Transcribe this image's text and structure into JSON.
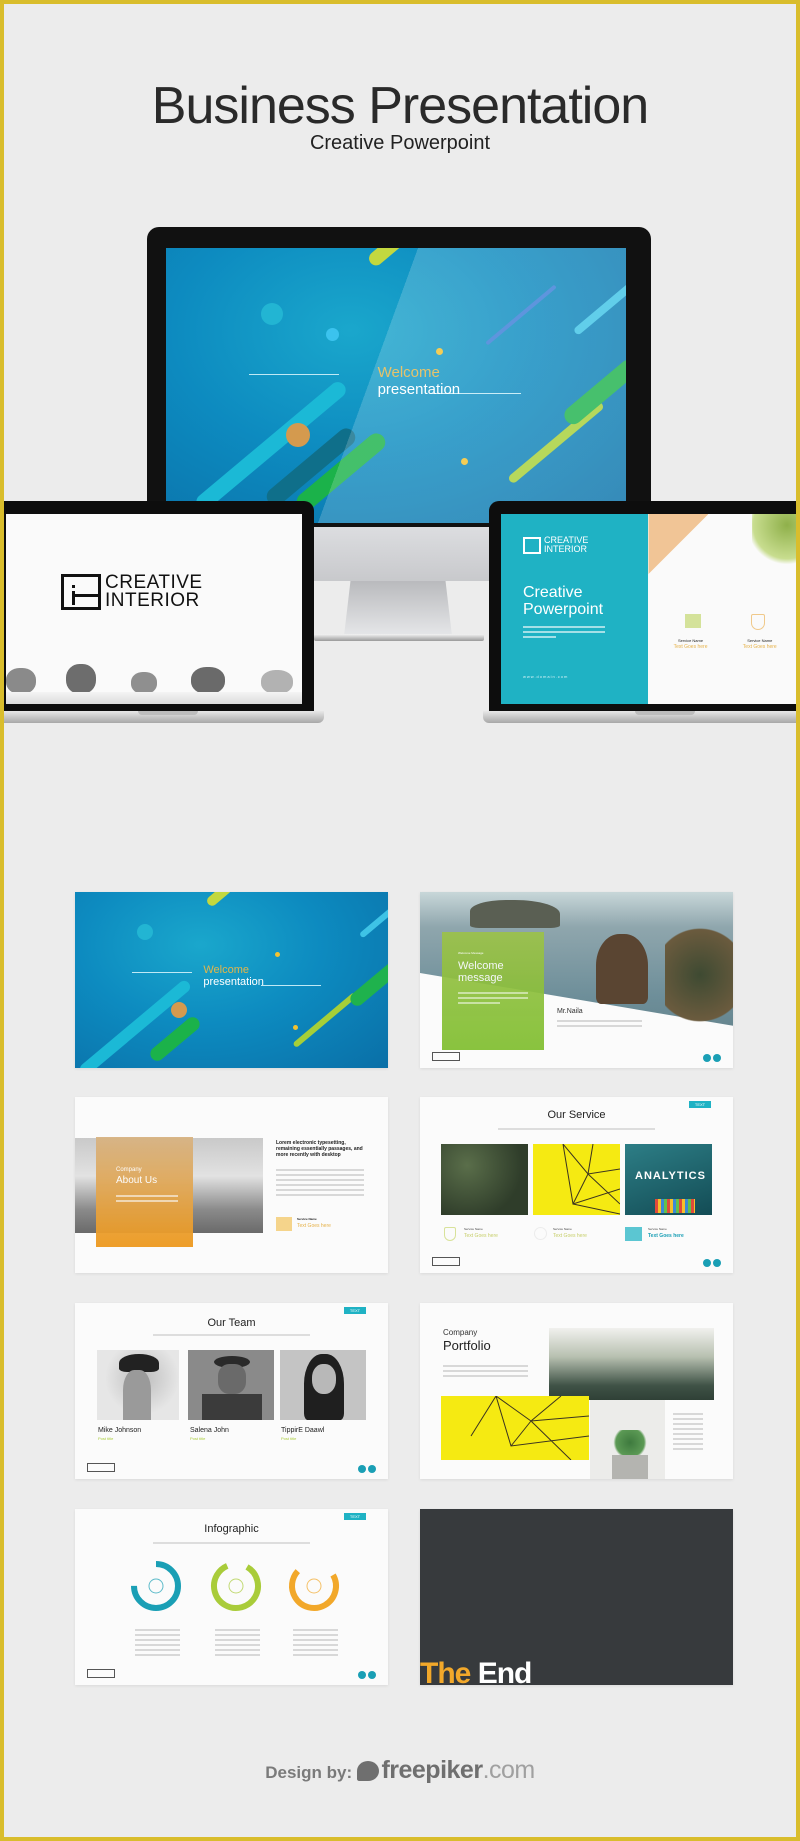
{
  "header": {
    "title": "Business Presentation",
    "subtitle": "Creative Powerpoint"
  },
  "devices": {
    "monitor": {
      "slide_line1": "Welcome",
      "slide_line2": "presentation"
    },
    "laptop_left": {
      "logo_line1": "CREATIVE",
      "logo_line2": "INTERIOR"
    },
    "laptop_right": {
      "logo_line1": "CREATIVE",
      "logo_line2": "INTERIOR",
      "title_line1": "Creative",
      "title_line2": "Powerpoint",
      "url": "www.domain.com",
      "features": [
        {
          "label": "Service Name",
          "value": "Text Goes here"
        },
        {
          "label": "Service Name",
          "value": "Text Goes here"
        }
      ]
    }
  },
  "slides": [
    {
      "id": "welcome",
      "line1": "Welcome",
      "line2": "presentation"
    },
    {
      "id": "welcome-message",
      "kicker": "Welcome Message",
      "title_line1": "Welcome",
      "title_line2": "message",
      "person": "Mr.Naila"
    },
    {
      "id": "about",
      "kicker": "Company",
      "title": "About Us",
      "headline": "Lorem electronic typesetting, remaining essentially passages, and more recently with desktop",
      "feature_label": "Service Name",
      "feature_value": "Text Goes here"
    },
    {
      "id": "service",
      "title": "Our Service",
      "tag": "TEXT",
      "board_text": "ANALYTICS",
      "features": [
        {
          "label": "Service Name",
          "value": "Text Goes here"
        },
        {
          "label": "Service Name",
          "value": "Text Goes here"
        },
        {
          "label": "Service Name",
          "value": "Text Goes here"
        }
      ]
    },
    {
      "id": "team",
      "title": "Our Team",
      "tag": "TEXT",
      "members": [
        {
          "name": "Mike Johnson",
          "role": "Post title"
        },
        {
          "name": "Salena John",
          "role": "Post title"
        },
        {
          "name": "TippirE Daawl",
          "role": "Post title"
        }
      ]
    },
    {
      "id": "portfolio",
      "kicker": "Company",
      "title": "Portfolio"
    },
    {
      "id": "infographic",
      "title": "Infographic",
      "tag": "TEXT",
      "rings": [
        {
          "icon": "pencil-edit-icon",
          "color": "#1a9fb5",
          "progress": 0.75
        },
        {
          "icon": "gear-icon",
          "color": "#a9cc3a",
          "progress": 0.85
        },
        {
          "icon": "globe-icon",
          "color": "#f2a82a",
          "progress": 0.7
        }
      ]
    },
    {
      "id": "end",
      "word1": "The",
      "word2": "End"
    }
  ],
  "colors": {
    "frame": "#d9bd2c",
    "teal": "#1fb2c4",
    "orange": "#f2a82a",
    "lime": "#a9cc3a"
  },
  "footer": {
    "label": "Design by:",
    "brand_bold": "freepiker",
    "brand_tld": ".com"
  }
}
